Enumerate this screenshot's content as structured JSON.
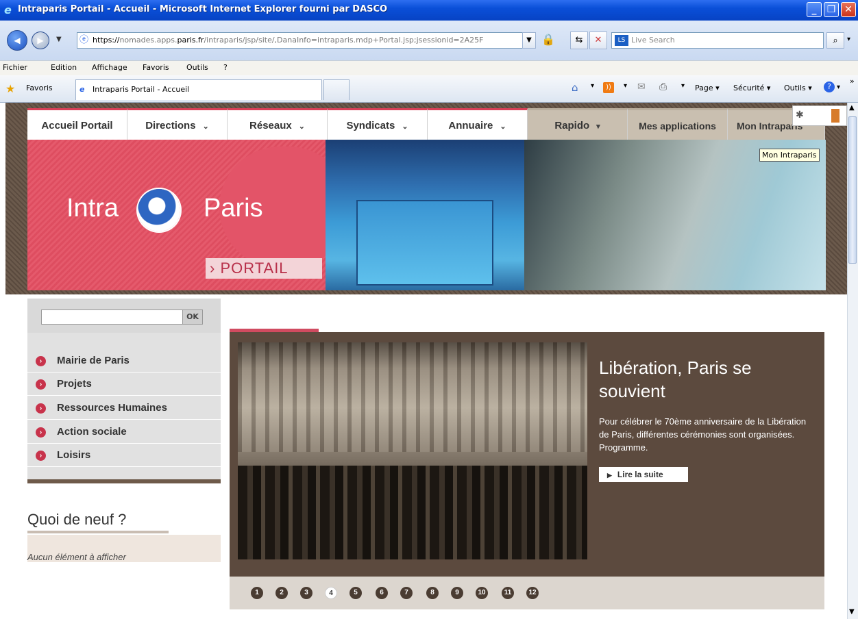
{
  "window": {
    "title": "Intraparis Portail - Accueil - Microsoft Internet Explorer fourni par DASCO"
  },
  "browser": {
    "address_prefix": "https://",
    "address_host_pre": "nomades.apps.",
    "address_domain": "paris.fr",
    "address_path": "/intraparis/jsp/site/,DanaInfo=intraparis.mdp+Portal.jsp;jsessionid=2A25F",
    "search_placeholder": "Live Search",
    "menu": [
      "Fichier",
      "Edition",
      "Affichage",
      "Favoris",
      "Outils",
      "?"
    ],
    "favorites_label": "Favoris",
    "tab_title": "Intraparis Portail - Accueil",
    "cmd_page": "Page",
    "cmd_securite": "Sécurité",
    "cmd_outils": "Outils"
  },
  "topnav": {
    "items": [
      "Accueil Portail",
      "Directions",
      "Réseaux",
      "Syndicats",
      "Annuaire",
      "Rapido",
      "Mes applications",
      "Mon Intraparis"
    ]
  },
  "tooltip": "Mon Intraparis",
  "banner": {
    "intra": "Intra",
    "paris": "Paris",
    "portail": "› PORTAIL"
  },
  "sidebar": {
    "search_button": "OK",
    "items": [
      "Mairie de Paris",
      "Projets",
      "Ressources Humaines",
      "Action sociale",
      "Loisirs"
    ],
    "news_title": "Quoi de neuf ?",
    "news_empty": "Aucun élément à afficher"
  },
  "feature": {
    "title": "Libération, Paris se souvient",
    "text": "Pour célébrer le 70ème anniversaire de la Libération de Paris, différentes cérémonies sont organisées. Programme.",
    "more": "Lire la suite",
    "pages": [
      "1",
      "2",
      "3",
      "4",
      "5",
      "6",
      "7",
      "8",
      "9",
      "10",
      "11",
      "12"
    ],
    "active_page": "4"
  },
  "colors": {
    "accent_red": "#d94057",
    "brown": "#5c4a3e"
  }
}
